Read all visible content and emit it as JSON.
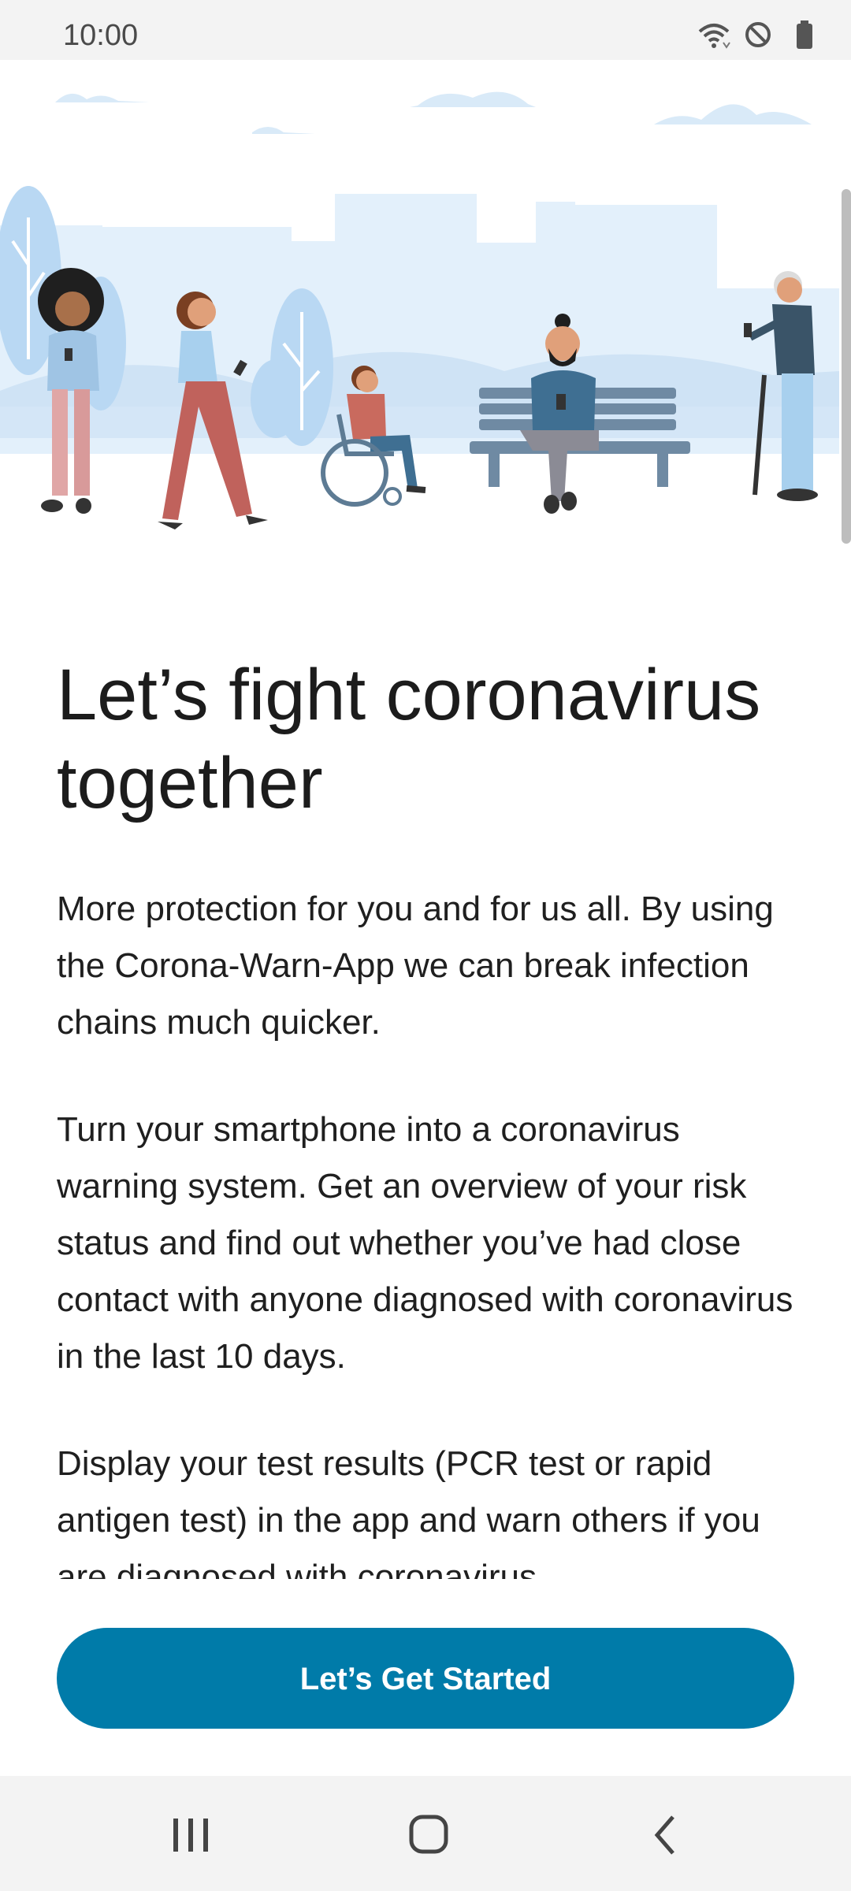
{
  "status_bar": {
    "time": "10:00",
    "icons": [
      "wifi-icon",
      "do-not-disturb-icon",
      "battery-icon"
    ]
  },
  "illustration": {
    "name": "people-in-park-illustration"
  },
  "main": {
    "title": "Let’s fight coronavirus together",
    "paragraphs": [
      "More protection for you and for us all. By using the Corona-Warn-App we can break infection chains much quicker.",
      "Turn your smartphone into a coronavirus warning system. Get an overview of your risk status and find out whether you’ve had close contact with anyone diagnosed with coronavirus in the last 10 days.",
      "Display your test results (PCR test or rapid antigen test) in the app and warn others if you are diagnosed with coronavirus."
    ]
  },
  "actions": {
    "start_label": "Let’s Get Started"
  },
  "nav": {
    "buttons": [
      "recents-icon",
      "home-icon",
      "back-icon"
    ]
  },
  "colors": {
    "accent": "#007ba9",
    "sky": "#e3f0fb"
  }
}
